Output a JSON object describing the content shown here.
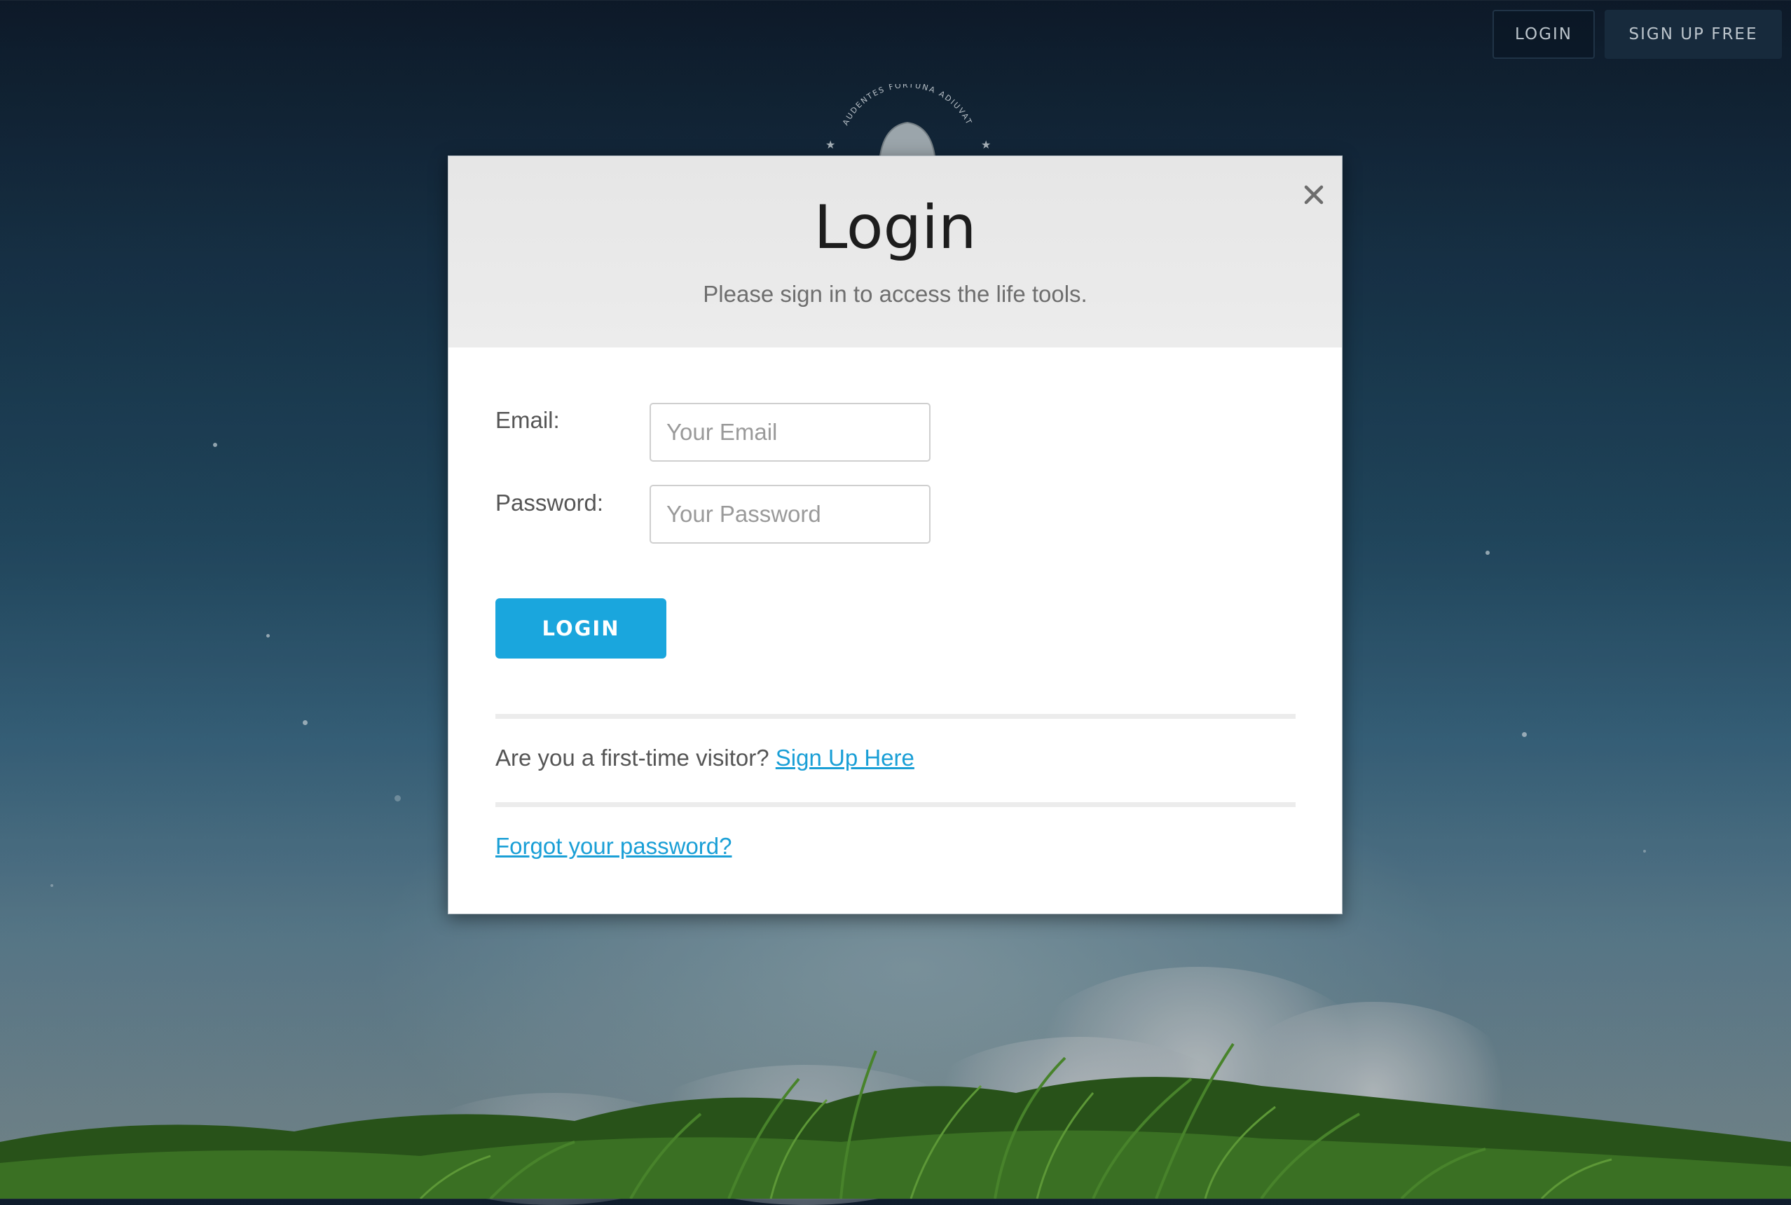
{
  "nav": {
    "login_label": "LOGIN",
    "signup_label": "SIGN UP FREE"
  },
  "emblem": {
    "motto": "AUDENTES FORTUNA ADIUVAT"
  },
  "modal": {
    "title": "Login",
    "subtitle": "Please sign in to access the life tools.",
    "close_icon": "close-icon",
    "email_label": "Email:",
    "email_placeholder": "Your Email",
    "email_value": "",
    "password_label": "Password:",
    "password_placeholder": "Your Password",
    "password_value": "",
    "login_button": "LOGIN",
    "visitor_prompt": "Are you a first-time visitor?",
    "signup_link": "Sign Up Here",
    "forgot_link": "Forgot your password?"
  },
  "colors": {
    "accent": "#1aa6dd",
    "link": "#1a9fd6",
    "header_bg": "#e8e8e8"
  }
}
